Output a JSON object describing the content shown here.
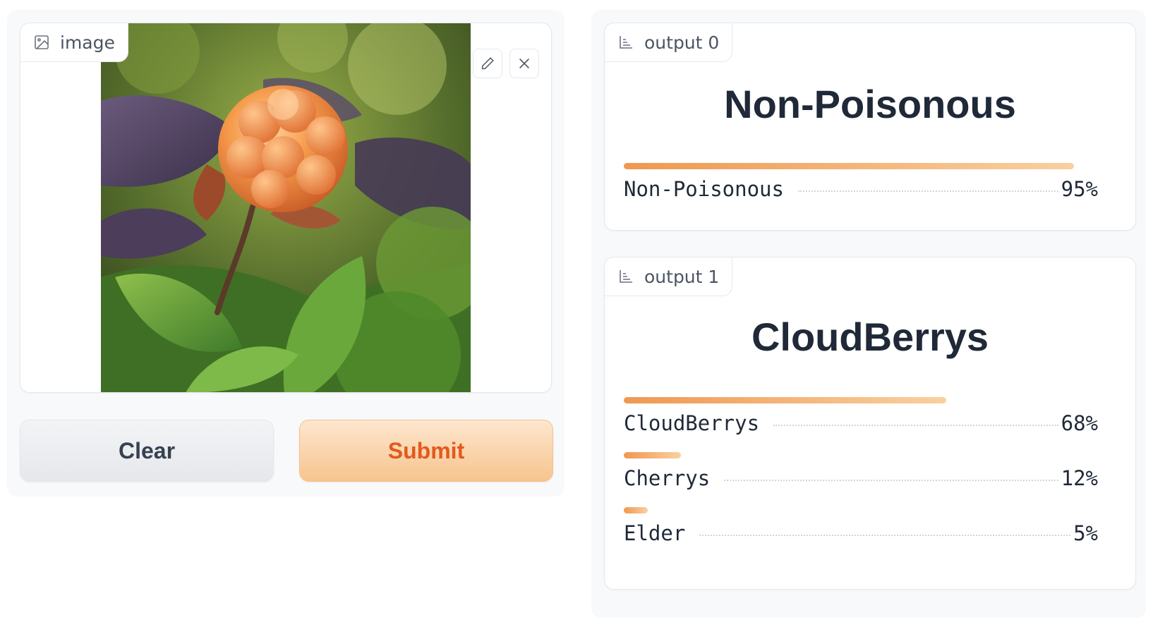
{
  "input": {
    "image_label": "image",
    "clear_label": "Clear",
    "submit_label": "Submit"
  },
  "outputs": [
    {
      "label": "output 0",
      "top_class": "Non-Poisonous",
      "confidences": [
        {
          "label": "Non-Poisonous",
          "percent": "95%",
          "value": 0.95
        }
      ]
    },
    {
      "label": "output 1",
      "top_class": "CloudBerrys",
      "confidences": [
        {
          "label": "CloudBerrys",
          "percent": "68%",
          "value": 0.68
        },
        {
          "label": "Cherrys",
          "percent": "12%",
          "value": 0.12
        },
        {
          "label": "Elder",
          "percent": "5%",
          "value": 0.05
        }
      ]
    }
  ],
  "colors": {
    "accent": "#e25a1c",
    "bar_start": "#ef9850",
    "bar_end": "#f9d0a0"
  },
  "icons": [
    "image-icon",
    "pencil-icon",
    "close-icon",
    "chart-icon"
  ]
}
